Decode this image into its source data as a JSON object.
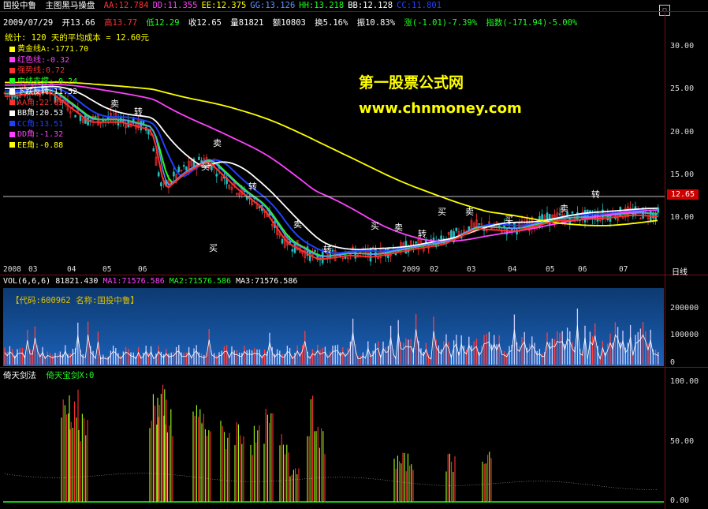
{
  "header": {
    "stock": "国投中鲁",
    "chart_title": "主图黑马操盘",
    "items": [
      {
        "label": "AA:12.784",
        "color": "#ff3030"
      },
      {
        "label": "DD:11.355",
        "color": "#ff40ff"
      },
      {
        "label": "EE:12.375",
        "color": "#ffff00"
      },
      {
        "label": "GG:13.126",
        "color": "#6090ff"
      },
      {
        "label": "HH:13.218",
        "color": "#20ff20"
      },
      {
        "label": "BB:12.128",
        "color": "#ffffff"
      },
      {
        "label": "CC:11.801",
        "color": "#2040ff"
      }
    ]
  },
  "info": {
    "date": "2009/07/29",
    "open": "开13.66",
    "high": "高13.77",
    "low": "低12.29",
    "close": "收12.65",
    "volume": "量81821",
    "amount": "额10803",
    "turnover": "换5.16%",
    "amplitude": "振10.83%",
    "change": "涨(-1.01)-7.39%",
    "index": "指数(-171.94)-5.00%"
  },
  "stats": "统计: 120 天的平均成本 = 12.60元",
  "legend": [
    {
      "label": "黄金线A:-1771.70",
      "color": "#ffff00"
    },
    {
      "label": "红色线:-0.32",
      "color": "#ff40ff"
    },
    {
      "label": "强势线:0.72",
      "color": "#ff3030"
    },
    {
      "label": "中线支撑:-0.24",
      "color": "#20ff20"
    },
    {
      "label": "下跌反转:11.52",
      "color": "#ffffff"
    },
    {
      "label": "AA角:22.03",
      "color": "#ff3030"
    },
    {
      "label": "BB角:20.53",
      "color": "#ffffff"
    },
    {
      "label": "CC角:13.51",
      "color": "#2040ff"
    },
    {
      "label": "DD角:-1.32",
      "color": "#ff40ff"
    },
    {
      "label": "EE角:-0.88",
      "color": "#ffff00"
    }
  ],
  "watermark": {
    "line1": "第一股票公式网",
    "line2": "www.chnmoney.com"
  },
  "price_axis": [
    "30.00",
    "25.00",
    "20.00",
    "15.00",
    "10.00"
  ],
  "price_tag": "12.65",
  "date_axis": [
    "2008",
    "03",
    "04",
    "05",
    "06",
    "2009",
    "02",
    "03",
    "04",
    "05",
    "06",
    "07"
  ],
  "day_type": "日线",
  "signals": [
    "卖",
    "转",
    "买",
    "卖",
    "转",
    "买",
    "卖",
    "转",
    "买",
    "卖",
    "转",
    "买",
    "卖",
    "买",
    "卖",
    "转"
  ],
  "volume_panel": {
    "label": "VOL(6,6,6)",
    "value": "81821.430",
    "ma1": "MA1:71576.586",
    "ma2": "MA2:71576.586",
    "ma3": "MA3:71576.586",
    "code_text": "【代码:600962 名称:国投中鲁】",
    "axis": [
      "200000",
      "100000",
      "0"
    ]
  },
  "indicator_panel": {
    "name": "倚天剑法",
    "line": "倚天宝剑X:0",
    "axis": [
      "100.00",
      "50.00",
      "0.00"
    ]
  },
  "colors": {
    "background": "#000000",
    "grid": "#7a1010",
    "up": "#ff3030",
    "down": "#20c0c0",
    "yellow": "#ffff00",
    "green": "#20ff20"
  }
}
